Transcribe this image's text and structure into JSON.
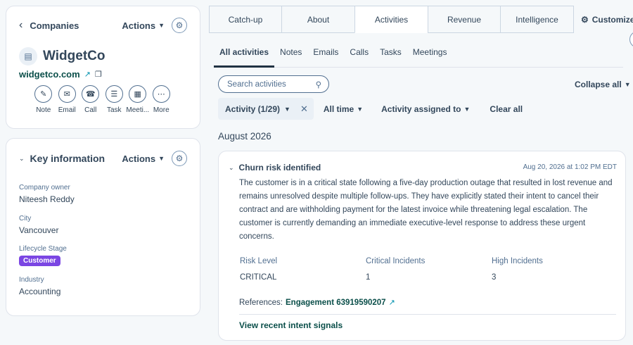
{
  "company_card": {
    "back_label": "Companies",
    "actions_label": "Actions",
    "name": "WidgetCo",
    "domain": "widgetco.com",
    "quick_actions": [
      {
        "label": "Note",
        "icon": "note-icon"
      },
      {
        "label": "Email",
        "icon": "email-icon"
      },
      {
        "label": "Call",
        "icon": "call-icon"
      },
      {
        "label": "Task",
        "icon": "task-icon"
      },
      {
        "label": "Meeti...",
        "icon": "meeting-icon"
      },
      {
        "label": "More",
        "icon": "more-icon"
      }
    ]
  },
  "key_info": {
    "title": "Key information",
    "actions_label": "Actions",
    "fields": [
      {
        "label": "Company owner",
        "value": "Niteesh Reddy"
      },
      {
        "label": "City",
        "value": "Vancouver"
      },
      {
        "label": "Lifecycle Stage",
        "value": "Customer"
      },
      {
        "label": "Industry",
        "value": "Accounting"
      }
    ]
  },
  "top_tabs": [
    "Catch-up",
    "About",
    "Activities",
    "Revenue",
    "Intelligence"
  ],
  "active_top_tab": "Activities",
  "customize_label": "Customize",
  "sub_tabs": [
    "All activities",
    "Notes",
    "Emails",
    "Calls",
    "Tasks",
    "Meetings"
  ],
  "search": {
    "placeholder": "Search activities"
  },
  "collapse_all_label": "Collapse all",
  "filters": {
    "activity_chip": "Activity (1/29)",
    "time": "All time",
    "assigned": "Activity assigned to",
    "clear": "Clear all"
  },
  "month_header": "August 2026",
  "activity": {
    "title": "Churn risk identified",
    "timestamp": "Aug 20, 2026 at 1:02 PM EDT",
    "body": "The customer is in a critical state following a five-day production outage that resulted in lost revenue and remains unresolved despite multiple follow-ups. They have explicitly stated their intent to cancel their contract and are withholding payment for the latest invoice while threatening legal escalation. The customer is currently demanding an immediate executive-level response to address these urgent concerns.",
    "metrics": [
      {
        "label": "Risk Level",
        "value": "CRITICAL"
      },
      {
        "label": "Critical Incidents",
        "value": "1"
      },
      {
        "label": "High Incidents",
        "value": "3"
      }
    ],
    "references_label": "References:",
    "reference_link": "Engagement 63919590207",
    "view_link": "View recent intent signals"
  },
  "colors": {
    "badge": "#7b46e3",
    "link": "#0b4f4a",
    "text": "#33475b"
  }
}
